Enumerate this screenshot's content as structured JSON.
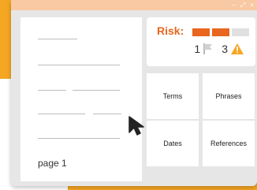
{
  "window": {
    "controls": [
      "–",
      "⤢",
      "×"
    ]
  },
  "document": {
    "page_label": "page 1"
  },
  "risk": {
    "label": "Risk:",
    "levels": [
      "#e8661d",
      "#e8661d",
      "#e0e0e0"
    ],
    "flag_count": "1",
    "warning_count": "3"
  },
  "tiles": [
    {
      "label": "Terms"
    },
    {
      "label": "Phrases"
    },
    {
      "label": "Dates"
    },
    {
      "label": "References"
    }
  ],
  "colors": {
    "accent": "#e8661d",
    "background_accent": "#f5a623",
    "warning": "#f5a623"
  }
}
